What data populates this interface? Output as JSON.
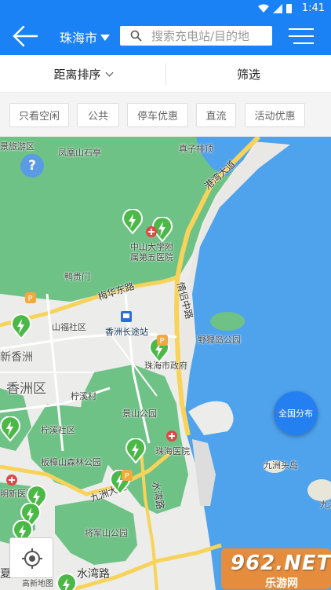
{
  "status_bar": {
    "time": "1:41"
  },
  "header": {
    "city": "珠海市",
    "search_placeholder": "搜索充电站/目的地"
  },
  "sort_bar": {
    "sort_label": "距离排序",
    "filter_label": "筛选"
  },
  "chips": [
    "只看空闲",
    "公共",
    "停车优惠",
    "直流",
    "活动优惠"
  ],
  "map": {
    "labels": {
      "tourist_area": "景旅游区",
      "fenghuang_stone": "凤凰山石亭",
      "zhenzi_pai": "真子排顶",
      "gangwan_avenue": "港湾大道",
      "hospital5_line1": "中山大学附",
      "hospital5_line2": "属第五医院",
      "yagui_gate": "鸭贵门",
      "meihua_east_rd": "梅华东路",
      "qinglv_rd": "情侣中路",
      "shanhu_community": "山福社区",
      "xiangzhou_bus": "香洲长途站",
      "yecui_park": "野狸岛公园",
      "new_xiangzhou": "新香洲",
      "govt": "珠海市政府",
      "xiangzhou_district": "香洲区",
      "ningxi_village": "柠溪村",
      "jingshan_park": "景山公园",
      "ningxi_community": "柠溪社区",
      "zhuhai_hospital": "珠海医院",
      "banzhang_park": "板樟山森林公园",
      "jiuzhou_ave": "九洲大道",
      "jiuzhou_head": "九洲头岛",
      "jiuzhou_right": "九洲",
      "mingli_hospital": "明新医院",
      "shuiwan_rd_v": "水湾路",
      "jiangjun_park": "将军山公园",
      "shuiwan_rd": "水湾路",
      "xia": "夏",
      "gaoxin": "高新地图"
    },
    "help_label": "?",
    "distribution_button": "全国分布",
    "watermark": "962.NET",
    "watermark_sub": "乐游网"
  },
  "colors": {
    "brand_blue": "#1a82f5",
    "pin_green": "#4cb848",
    "sea": "#4fa3ec",
    "land_green": "#6fc286"
  }
}
